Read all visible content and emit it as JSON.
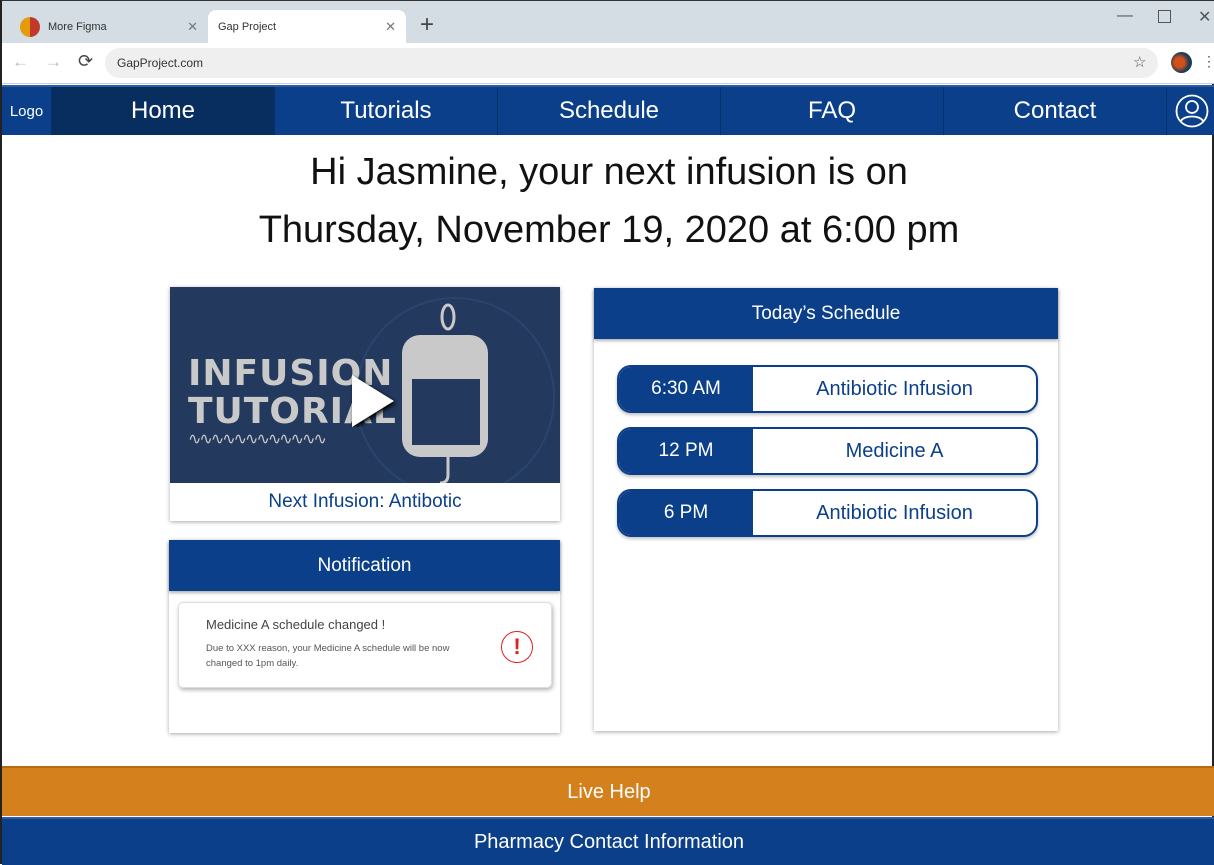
{
  "browser": {
    "tabs": [
      {
        "label": "More Figma"
      },
      {
        "label": "Gap Project"
      }
    ],
    "url": "GapProject.com"
  },
  "nav": {
    "logo": "Logo",
    "items": [
      "Home",
      "Tutorials",
      "Schedule",
      "FAQ",
      "Contact"
    ],
    "active": "Home"
  },
  "greeting": {
    "line1": "Hi Jasmine, your next infusion is on",
    "line2": "Thursday, November 19, 2020 at 6:00 pm"
  },
  "video": {
    "thumb_line1": "INFUSION",
    "thumb_line2": "TUTORIAL",
    "caption": "Next Infusion: Antibotic"
  },
  "notification": {
    "title": "Notification",
    "item_title": "Medicine A schedule changed !",
    "item_body": "Due to XXX reason, your Medicine A schedule will be now changed to 1pm daily.",
    "icon": "exclamation-circle-icon"
  },
  "schedule": {
    "title": "Today’s Schedule",
    "items": [
      {
        "time": "6:30 AM",
        "name": "Antibiotic Infusion"
      },
      {
        "time": "12 PM",
        "name": "Medicine A"
      },
      {
        "time": "6 PM",
        "name": "Antibiotic Infusion"
      }
    ]
  },
  "footer": {
    "live_help": "Live Help",
    "pharmacy": "Pharmacy Contact Information"
  },
  "colors": {
    "primary": "#0b3f8a",
    "nav_active": "#082e60",
    "accent": "#d4801c",
    "alert": "#e02020"
  }
}
